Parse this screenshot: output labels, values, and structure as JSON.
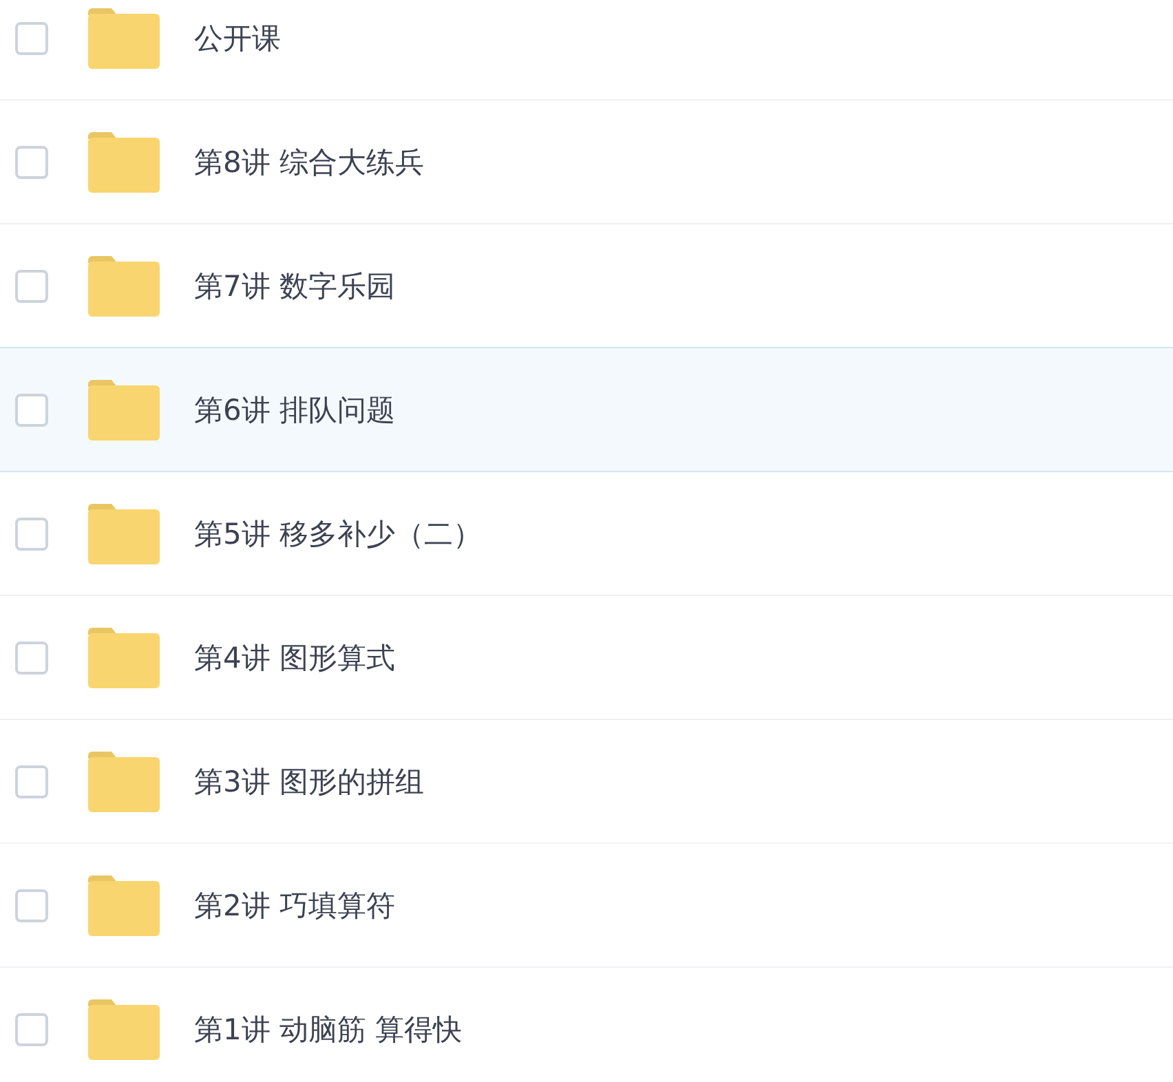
{
  "files": [
    {
      "name": "公开课",
      "checked": false,
      "selected": false
    },
    {
      "name": "第8讲 综合大练兵",
      "checked": false,
      "selected": false
    },
    {
      "name": "第7讲 数字乐园",
      "checked": false,
      "selected": false
    },
    {
      "name": "第6讲 排队问题",
      "checked": false,
      "selected": true
    },
    {
      "name": "第5讲 移多补少（二）",
      "checked": false,
      "selected": false
    },
    {
      "name": "第4讲 图形算式",
      "checked": false,
      "selected": false
    },
    {
      "name": "第3讲 图形的拼组",
      "checked": false,
      "selected": false
    },
    {
      "name": "第2讲 巧填算符",
      "checked": false,
      "selected": false
    },
    {
      "name": "第1讲 动脑筋 算得快",
      "checked": false,
      "selected": false
    }
  ]
}
